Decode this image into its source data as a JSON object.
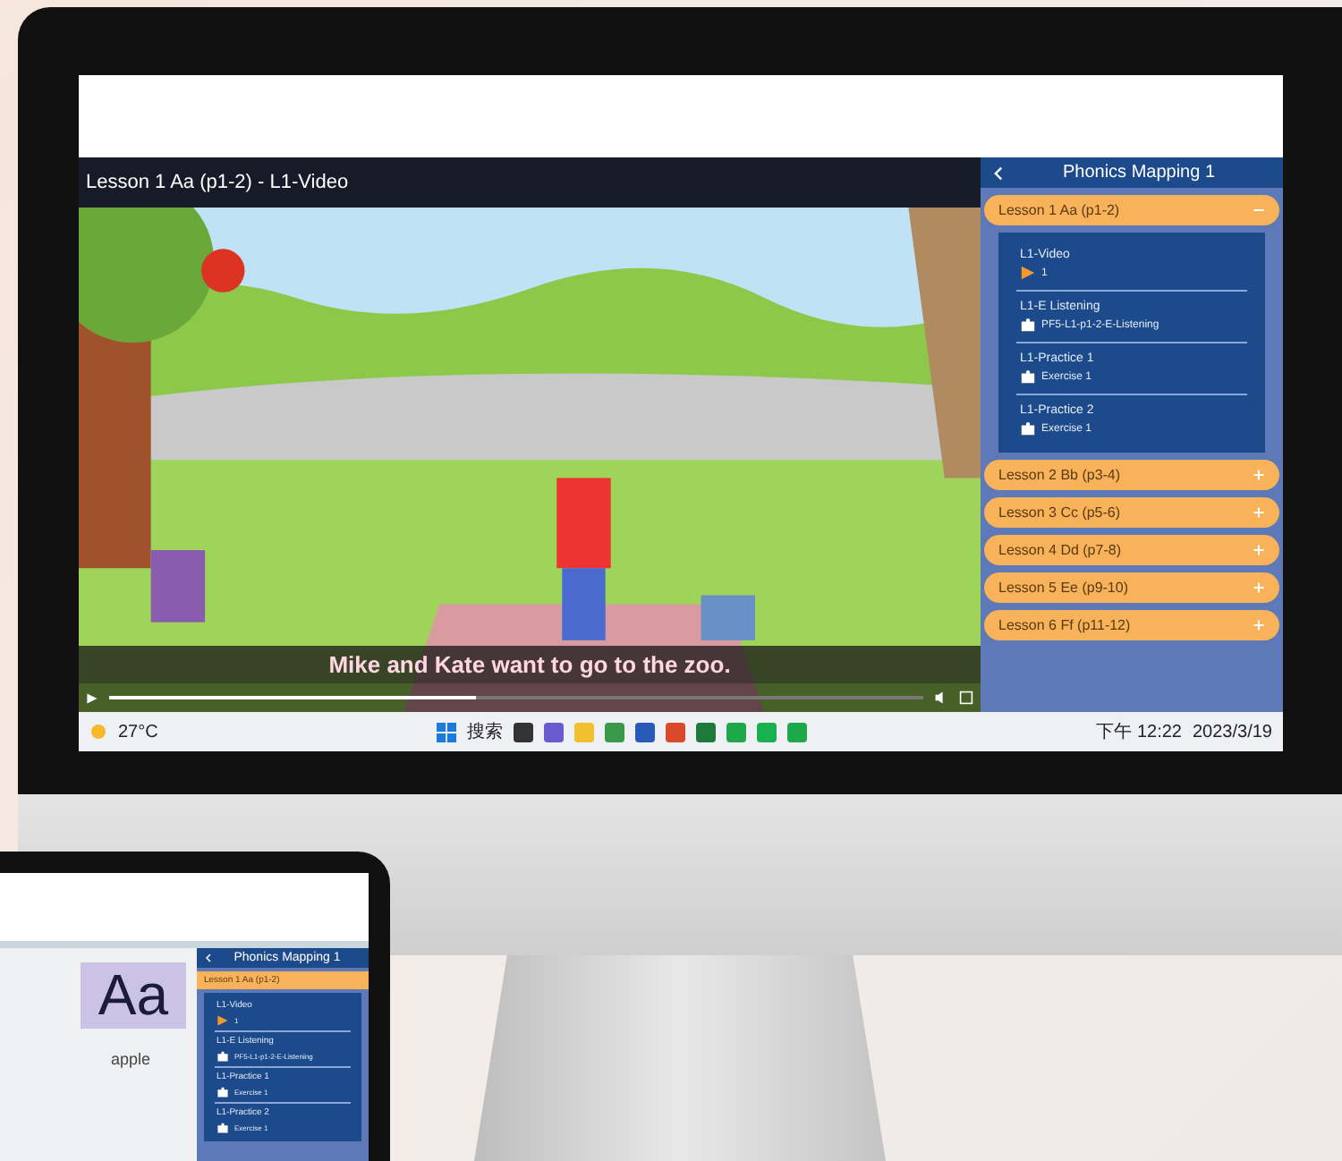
{
  "monitor": {
    "video_title": "Lesson 1 Aa (p1-2) - L1-Video",
    "subtitle": "Mike and Kate want to go to the zoo.",
    "progress": {
      "level": 0.45
    },
    "sidebar": {
      "title": "Phonics Mapping 1",
      "lessons": [
        {
          "label": "Lesson 1 Aa (p1-2)",
          "expanded": true,
          "items": [
            {
              "title": "L1-Video",
              "kind": "video",
              "sub": "1"
            },
            {
              "title": "L1-E Listening",
              "kind": "exercise",
              "sub": "PF5-L1-p1-2-E-Listening"
            },
            {
              "title": "L1-Practice 1",
              "kind": "exercise",
              "sub": "Exercise 1"
            },
            {
              "title": "L1-Practice 2",
              "kind": "exercise",
              "sub": "Exercise 1"
            }
          ]
        },
        {
          "label": "Lesson 2 Bb (p3-4)",
          "expanded": false
        },
        {
          "label": "Lesson 3 Cc (p5-6)",
          "expanded": false
        },
        {
          "label": "Lesson 4 Dd (p7-8)",
          "expanded": false
        },
        {
          "label": "Lesson 5 Ee (p9-10)",
          "expanded": false
        },
        {
          "label": "Lesson 6 Ff (p11-12)",
          "expanded": false
        }
      ]
    },
    "taskbar": {
      "weather": "27°C",
      "search": "搜索",
      "time": "下午 12:22",
      "date": "2023/3/19"
    }
  },
  "laptop": {
    "letter": "Aa",
    "word": "apple",
    "sidebar": {
      "title": "Phonics Mapping 1",
      "lesson": "Lesson 1 Aa (p1-2)",
      "items": [
        {
          "title": "L1-Video",
          "kind": "video",
          "sub": "1"
        },
        {
          "title": "L1-E Listening",
          "kind": "exercise",
          "sub": "PF5-L1-p1-2-E-Listening"
        },
        {
          "title": "L1-Practice 1",
          "kind": "exercise",
          "sub": "Exercise 1"
        },
        {
          "title": "L1-Practice 2",
          "kind": "exercise",
          "sub": "Exercise 1"
        }
      ]
    }
  }
}
